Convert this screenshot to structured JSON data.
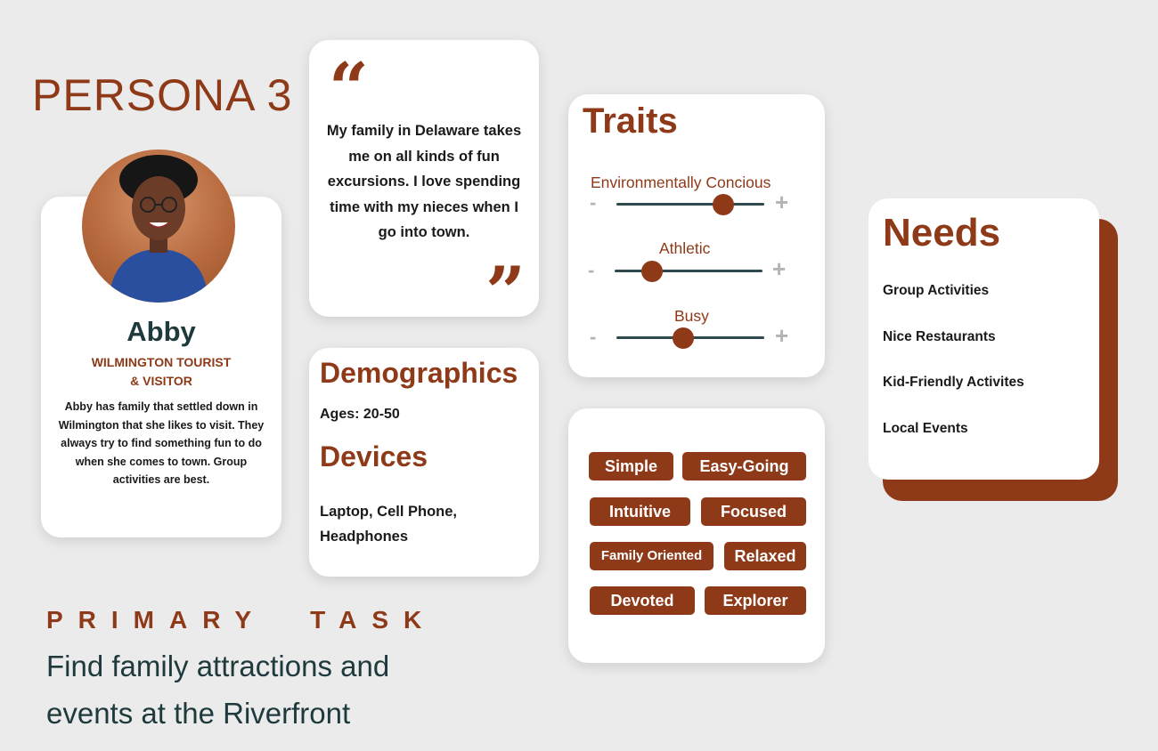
{
  "persona": {
    "title": "PERSONA 3"
  },
  "profile": {
    "name": "Abby",
    "role_line1": "WILMINGTON TOURIST",
    "role_line2": "& VISITOR",
    "bio": "Abby has family that settled down in Wilmington that she likes to visit. They always try to find something fun to do when she comes to town. Group activities are best."
  },
  "quote": {
    "open_mark": "“",
    "text": "My family in Delaware takes me on all kinds of fun excursions. I love spending time with my nieces when I go into town.",
    "close_mark": "”"
  },
  "demographics": {
    "heading": "Demographics",
    "ages": "Ages: 20-50",
    "devices_heading": "Devices",
    "devices": "Laptop, Cell Phone, Headphones"
  },
  "traits": {
    "heading": "Traits",
    "minus": "-",
    "plus": "+",
    "items": [
      {
        "label": "Environmentally Concious",
        "level": 0.72
      },
      {
        "label": "Athletic",
        "level": 0.25
      },
      {
        "label": "Busy",
        "level": 0.45
      }
    ]
  },
  "tags": [
    "Simple",
    "Easy-Going",
    "Intuitive",
    "Focused",
    "Family Oriented",
    "Relaxed",
    "Devoted",
    "Explorer"
  ],
  "needs": {
    "heading": "Needs",
    "items": [
      "Group Activities",
      "Nice Restaurants",
      "Kid-Friendly Activites",
      "Local Events"
    ]
  },
  "primary_task": {
    "label": "PRIMARY  TASK",
    "text": "Find family attractions and events at the Riverfront"
  },
  "colors": {
    "accent": "#8e3a19",
    "dark_teal": "#1f3a3d",
    "background": "#ebebeb"
  }
}
